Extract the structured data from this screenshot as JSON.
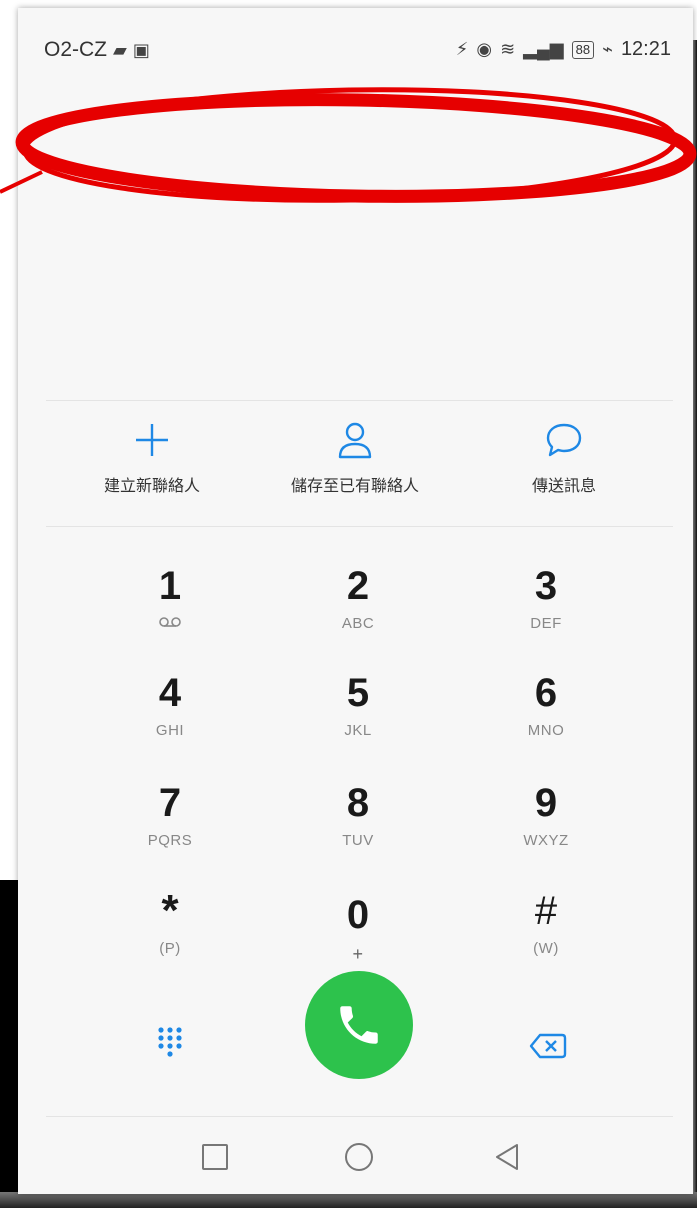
{
  "status_bar": {
    "carrier": "O2-CZ",
    "battery": "88",
    "time": "12:21"
  },
  "actions": [
    {
      "label": "建立新聯絡人",
      "icon": "plus-icon"
    },
    {
      "label": "儲存至已有聯絡人",
      "icon": "person-icon"
    },
    {
      "label": "傳送訊息",
      "icon": "chat-bubble-icon"
    }
  ],
  "keypad": [
    {
      "digit": "1",
      "letters": "",
      "icon": "voicemail-icon"
    },
    {
      "digit": "2",
      "letters": "ABC"
    },
    {
      "digit": "3",
      "letters": "DEF"
    },
    {
      "digit": "4",
      "letters": "GHI"
    },
    {
      "digit": "5",
      "letters": "JKL"
    },
    {
      "digit": "6",
      "letters": "MNO"
    },
    {
      "digit": "7",
      "letters": "PQRS"
    },
    {
      "digit": "8",
      "letters": "TUV"
    },
    {
      "digit": "9",
      "letters": "WXYZ"
    },
    {
      "digit": "*",
      "letters": "(P)"
    },
    {
      "digit": "0",
      "letters": "+"
    },
    {
      "digit": "#",
      "letters": "(W)"
    }
  ],
  "colors": {
    "accent": "#1e88e5",
    "call_green": "#2dc24c",
    "annotation_red": "#e60000"
  }
}
